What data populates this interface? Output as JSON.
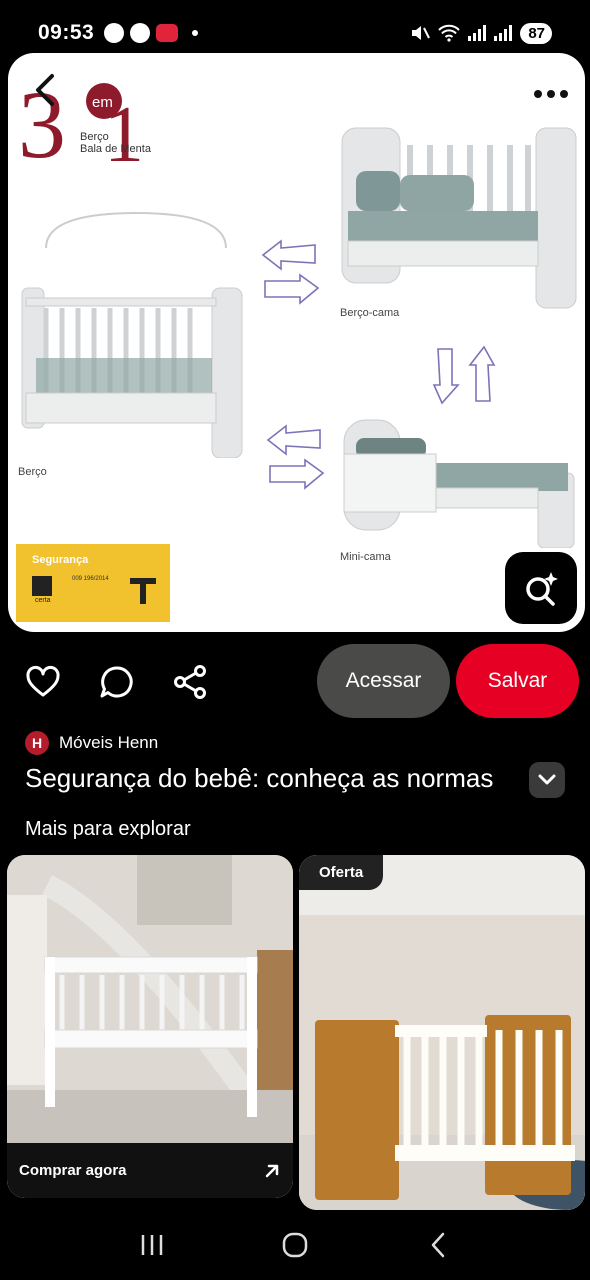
{
  "status_bar": {
    "time": "09:53",
    "battery": "87"
  },
  "pin": {
    "brand_logo_text": "3em1",
    "brand_sub_line1": "Berço",
    "brand_sub_line2": "Bala de Menta",
    "captions": {
      "berco": "Berço",
      "berco_cama": "Berço-cama",
      "mini_cama": "Mini-cama"
    },
    "seal": {
      "title": "Segurança",
      "number": "009 196/2014"
    },
    "icons": {
      "back": "chevron-left-icon",
      "more": "more-horizontal-icon",
      "lens": "visual-search-icon"
    }
  },
  "actions": {
    "like_icon": "heart-icon",
    "comment_icon": "comment-icon",
    "share_icon": "share-icon",
    "acessar_label": "Acessar",
    "salvar_label": "Salvar",
    "accent_color": "#e60023"
  },
  "creator": {
    "avatar_letter": "H",
    "name": "Móveis Henn"
  },
  "pin_title": "Segurança do bebê: conheça as normas",
  "section_title": "Mais para explorar",
  "grid": [
    {
      "cta_label": "Comprar agora",
      "cta_icon": "arrow-up-right-icon"
    },
    {
      "badge": "Oferta"
    }
  ],
  "nav": {
    "recent_icon": "recent-apps-icon",
    "home_icon": "home-icon",
    "back_icon": "back-icon"
  }
}
